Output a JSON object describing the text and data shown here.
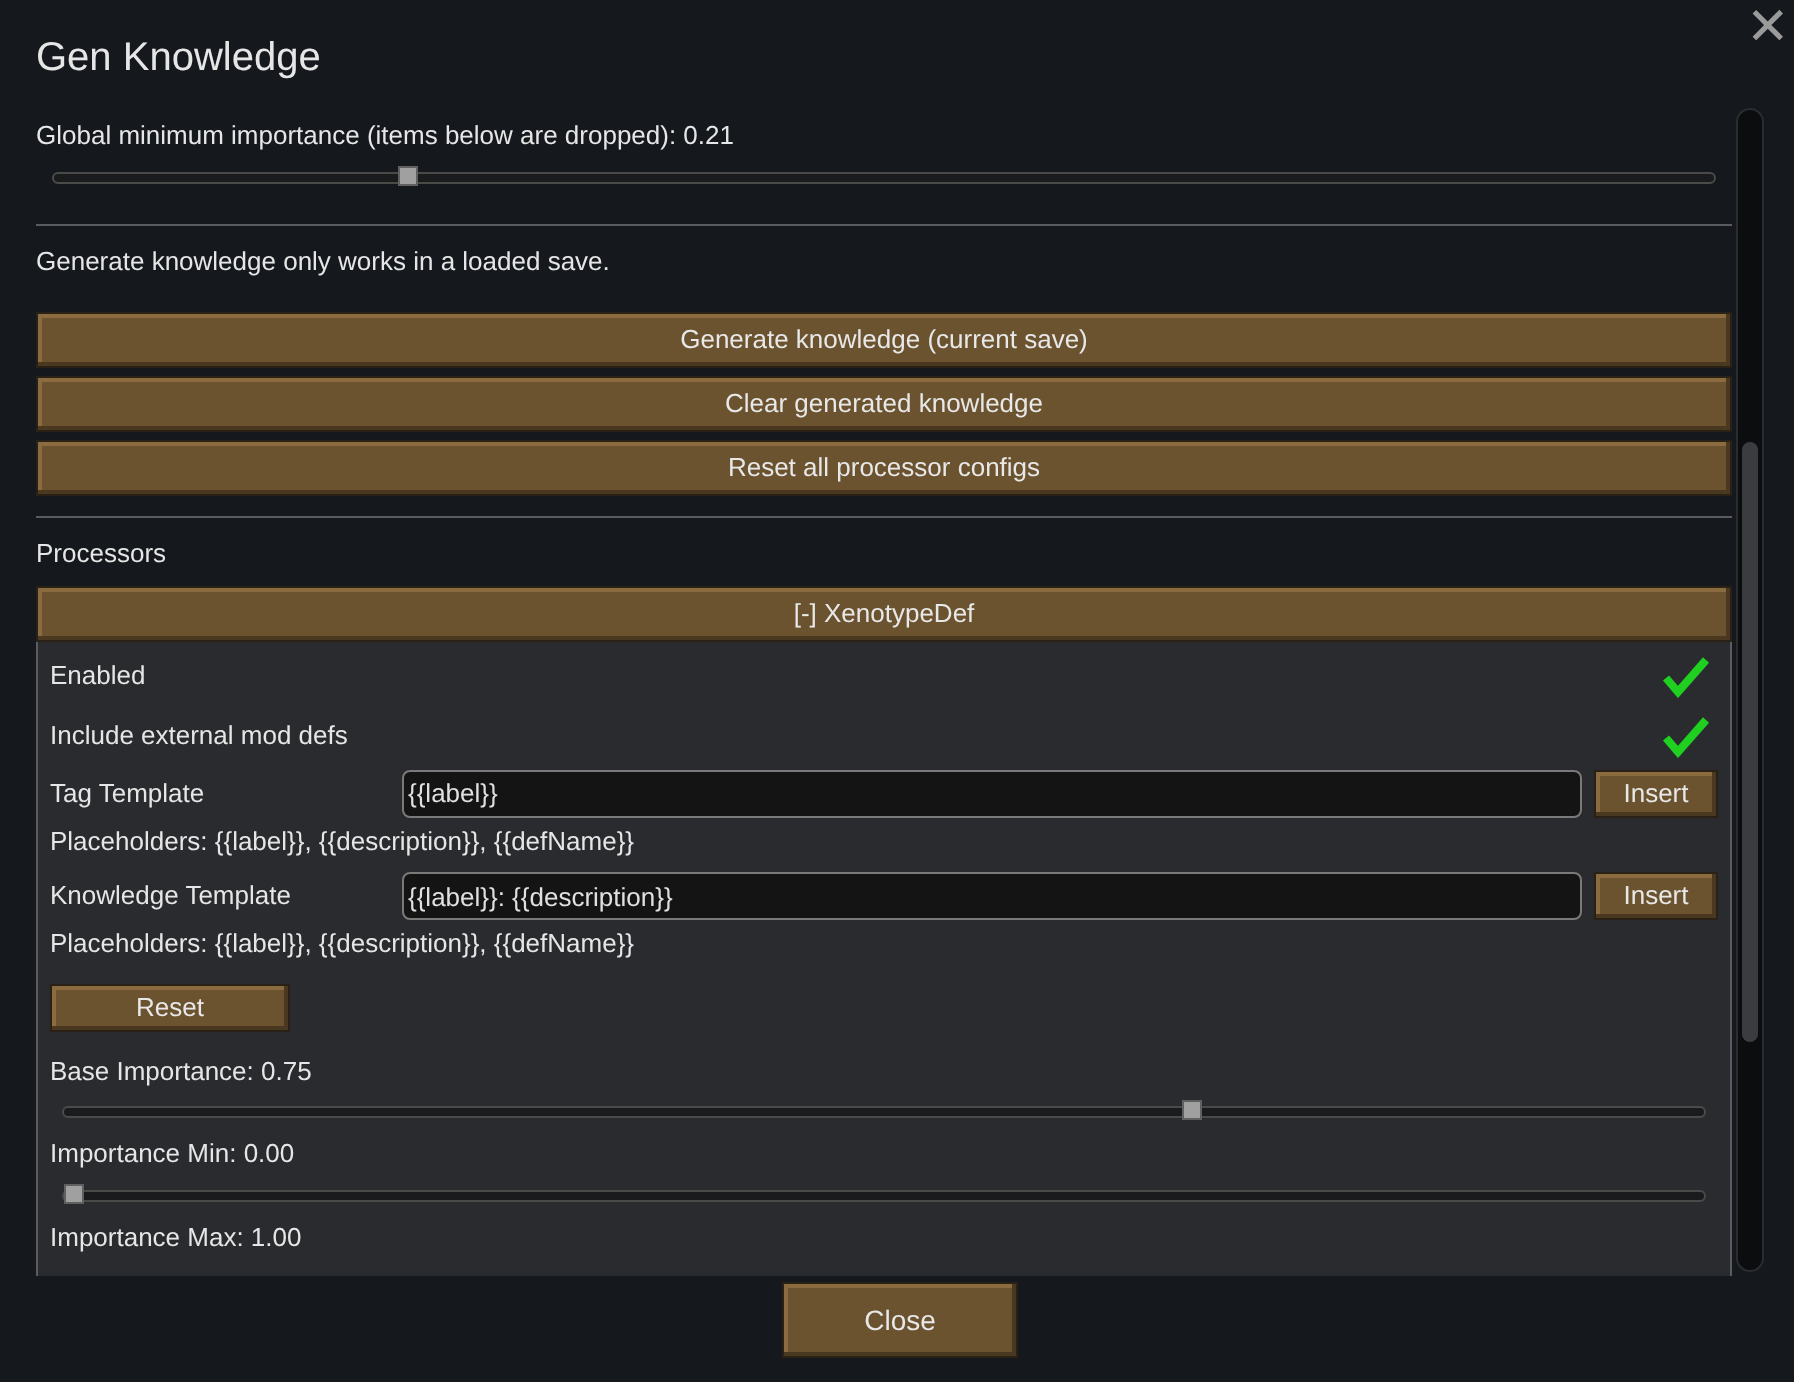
{
  "window": {
    "title": "Gen Knowledge",
    "close_glyph": "✕"
  },
  "global_slider": {
    "label": "Global minimum importance (items below are dropped): 0.21",
    "level": 0.21
  },
  "note": "Generate knowledge only works in a loaded save.",
  "actions": [
    "Generate knowledge (current save)",
    "Clear generated knowledge",
    "Reset all processor configs"
  ],
  "processors": {
    "heading": "Processors",
    "header": "[-] XenotypeDef",
    "settings": [
      {
        "kind": "check",
        "label": "Enabled",
        "checked": true
      },
      {
        "kind": "check",
        "label": "Include external mod defs",
        "checked": true
      },
      {
        "kind": "template",
        "label": "Tag Template",
        "value": "{{label}}",
        "button": "Insert",
        "hint": "Placeholders: {{label}}, {{description}}, {{defName}}"
      },
      {
        "kind": "template",
        "label": "Knowledge Template",
        "value": "{{label}}: {{description}}",
        "button": "Insert",
        "hint": "Placeholders: {{label}}, {{description}}, {{defName}}"
      },
      {
        "kind": "button",
        "label": "Reset"
      },
      {
        "kind": "slider",
        "label": "Base Importance: 0.75",
        "level": 0.69
      },
      {
        "kind": "slider",
        "label": "Importance Min: 0.00",
        "level": 0
      },
      {
        "kind": "text",
        "label": "Importance Max: 1.00"
      }
    ]
  },
  "footer": {
    "button": "Close"
  }
}
